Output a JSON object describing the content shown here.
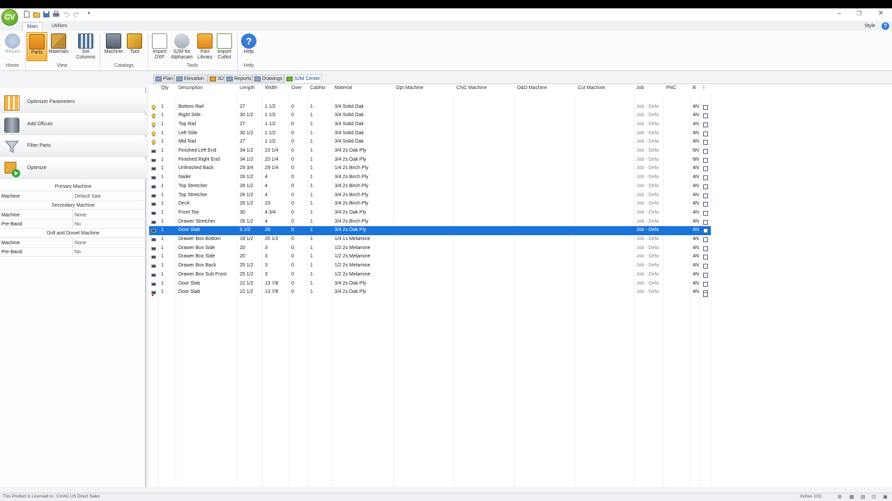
{
  "app": {
    "logo_text": "CV"
  },
  "ribbon_tabs": [
    {
      "label": "Main"
    },
    {
      "label": "Utilities"
    }
  ],
  "style_label": "Style",
  "ribbon": {
    "home": {
      "return_label": "Return",
      "group_label": "Home"
    },
    "view": {
      "parts_label": "Parts",
      "materials_label": "Materials",
      "set_columns_label": "Set Columns",
      "group_label": "View"
    },
    "catalogs": {
      "machine_label": "Machine",
      "tool_label": "Tool",
      "group_label": "Catalogs"
    },
    "tools": {
      "import_dxf_label": "Import DXF",
      "s2m_alphacam_label": "S2M for Alphacam",
      "part_library_label": "Part Library",
      "import_cutlist_label": "Import Cutlist",
      "group_label": "Tools"
    },
    "help": {
      "help_label": "Help",
      "group_label": "Help"
    }
  },
  "left_panel": {
    "actions": [
      "Optimizer Parameters",
      "Add Offcuts",
      "Filter Parts",
      "Optimize"
    ],
    "primary": {
      "title": "Primary Machine",
      "machine_key": "Machine",
      "machine_value": "Default Saw"
    },
    "secondary": {
      "title": "Secondary Machine",
      "machine_key": "Machine",
      "machine_value": "None",
      "preband_key": "Pre-Band",
      "preband_value": "No"
    },
    "drill": {
      "title": "Drill and Dowel Machine",
      "machine_key": "Machine",
      "machine_value": "None",
      "preband_key": "Pre-Band",
      "preband_value": "No"
    }
  },
  "doc_tabs": [
    "Plan",
    "Elevation",
    "3D",
    "Reports",
    "Drawings",
    "S2M Center"
  ],
  "grid": {
    "columns": [
      "Qty",
      "Description",
      "Length",
      "Width",
      "Over",
      "CabNo",
      "Material",
      "Opt Machine",
      "CNC Machine",
      "D&D Machine",
      "Cut Machine",
      "Job",
      "PNC",
      "B",
      "I"
    ],
    "rows": [
      {
        "qty": "1",
        "desc": "Bottom Rail",
        "length": "27",
        "width": "1 1/2",
        "over": "0",
        "cab": "1",
        "material": "3/4 Solid Oak",
        "job": "Job - Defa",
        "b": "4N",
        "icon": "rail"
      },
      {
        "qty": "1",
        "desc": "Right Stile",
        "length": "30 1/2",
        "width": "1 1/2",
        "over": "0",
        "cab": "1",
        "material": "3/4 Solid Oak",
        "job": "Job - Defa",
        "b": "4N",
        "icon": "rail"
      },
      {
        "qty": "1",
        "desc": "Top Rail",
        "length": "27",
        "width": "1 1/2",
        "over": "0",
        "cab": "1",
        "material": "3/4 Solid Oak",
        "job": "Job - Defa",
        "b": "4N",
        "icon": "rail"
      },
      {
        "qty": "1",
        "desc": "Left Stile",
        "length": "30 1/2",
        "width": "1 1/2",
        "over": "0",
        "cab": "1",
        "material": "3/4 Solid Oak",
        "job": "Job - Defa",
        "b": "4N",
        "icon": "rail"
      },
      {
        "qty": "1",
        "desc": "Mid Rail",
        "length": "27",
        "width": "1 1/2",
        "over": "0",
        "cab": "1",
        "material": "3/4 Solid Oak",
        "job": "Job - Defa",
        "b": "4N",
        "icon": "rail"
      },
      {
        "qty": "1",
        "desc": "Finished Left End",
        "length": "34 1/2",
        "width": "23 1/4",
        "over": "0",
        "cab": "1",
        "material": "3/4 2s Oak Ply",
        "job": "Job - Defa",
        "b": "6N",
        "icon": "panel"
      },
      {
        "qty": "1",
        "desc": "Finished Right End",
        "length": "34 1/2",
        "width": "23 1/4",
        "over": "0",
        "cab": "1",
        "material": "3/4 2s Oak Ply",
        "job": "Job - Defa",
        "b": "6N",
        "icon": "panel"
      },
      {
        "qty": "1",
        "desc": "Unfinished Back",
        "length": "29 3/4",
        "width": "29 1/4",
        "over": "0",
        "cab": "1",
        "material": "1/4 2s Birch Ply",
        "job": "Job - Defa",
        "b": "4N",
        "icon": "panel"
      },
      {
        "qty": "1",
        "desc": "Nailer",
        "length": "28 1/2",
        "width": "4",
        "over": "0",
        "cab": "1",
        "material": "3/4 2s Birch Ply",
        "job": "Job - Defa",
        "b": "4N",
        "icon": "panel"
      },
      {
        "qty": "1",
        "desc": "Top Stretcher",
        "length": "28 1/2",
        "width": "4",
        "over": "0",
        "cab": "1",
        "material": "3/4 2s Birch Ply",
        "job": "Job - Defa",
        "b": "4N",
        "icon": "panel"
      },
      {
        "qty": "1",
        "desc": "Top Stretcher",
        "length": "28 1/2",
        "width": "4",
        "over": "0",
        "cab": "1",
        "material": "3/4 2s Birch Ply",
        "job": "Job - Defa",
        "b": "4N",
        "icon": "panel"
      },
      {
        "qty": "1",
        "desc": "Deck",
        "length": "28 1/2",
        "width": "23",
        "over": "0",
        "cab": "1",
        "material": "3/4 2s Birch Ply",
        "job": "Job - Defa",
        "b": "4N",
        "icon": "panel"
      },
      {
        "qty": "1",
        "desc": "Front Toe",
        "length": "30",
        "width": "4 3/4",
        "over": "0",
        "cab": "1",
        "material": "3/4 2s Oak Ply",
        "job": "Job - Defa",
        "b": "4N",
        "icon": "panel"
      },
      {
        "qty": "1",
        "desc": "Drawer Stretcher",
        "length": "28 1/2",
        "width": "4",
        "over": "0",
        "cab": "1",
        "material": "3/4 2s Birch Ply",
        "job": "Job - Defa",
        "b": "4N",
        "icon": "panel"
      },
      {
        "qty": "1",
        "desc": "Door Slab",
        "length": "5 1/2",
        "width": "28",
        "over": "0",
        "cab": "1",
        "material": "3/4 2s Oak Ply",
        "job": "Job - Defa",
        "b": "4N",
        "icon": "panel",
        "selected": true
      },
      {
        "qty": "1",
        "desc": "Drawer Box Bottom",
        "length": "19 1/2",
        "width": "25 1/2",
        "over": "0",
        "cab": "1",
        "material": "1/4 1s Melamine",
        "job": "Job - Defa",
        "b": "4N",
        "icon": "panel"
      },
      {
        "qty": "1",
        "desc": "Drawer Box Side",
        "length": "20",
        "width": "3",
        "over": "0",
        "cab": "1",
        "material": "1/2 2s Melamine",
        "job": "Job - Defa",
        "b": "4N",
        "icon": "panel"
      },
      {
        "qty": "1",
        "desc": "Drawer Box Side",
        "length": "20",
        "width": "3",
        "over": "0",
        "cab": "1",
        "material": "1/2 2s Melamine",
        "job": "Job - Defa",
        "b": "4N",
        "icon": "panel"
      },
      {
        "qty": "1",
        "desc": "Drawer Box Back",
        "length": "25 1/2",
        "width": "3",
        "over": "0",
        "cab": "1",
        "material": "1/2 2s Melamine",
        "job": "Job - Defa",
        "b": "4N",
        "icon": "panel"
      },
      {
        "qty": "1",
        "desc": "Drawer Box Sub Front",
        "length": "25 1/2",
        "width": "3",
        "over": "0",
        "cab": "1",
        "material": "1/2 2s Melamine",
        "job": "Job - Defa",
        "b": "4N",
        "icon": "panel"
      },
      {
        "qty": "1",
        "desc": "Door Slab",
        "length": "22 1/2",
        "width": "13 7/8",
        "over": "0",
        "cab": "1",
        "material": "3/4 2s Oak Ply",
        "job": "Job - Defa",
        "b": "4N",
        "icon": "panel"
      },
      {
        "qty": "1",
        "desc": "Door Slab",
        "length": "22 1/2",
        "width": "13 7/8",
        "over": "0",
        "cab": "1",
        "material": "3/4 2s Oak Ply",
        "job": "Job - Defa",
        "b": "4N",
        "icon": "panel"
      }
    ]
  },
  "status": {
    "license_text": "This Product is Licensed to : CV/AC US Direct Sales",
    "units_text": "Inches  1/32"
  },
  "colors": {
    "selection": "#1a73d9",
    "accent": "#3a7bd5",
    "brand_green": "#6bb32e"
  }
}
